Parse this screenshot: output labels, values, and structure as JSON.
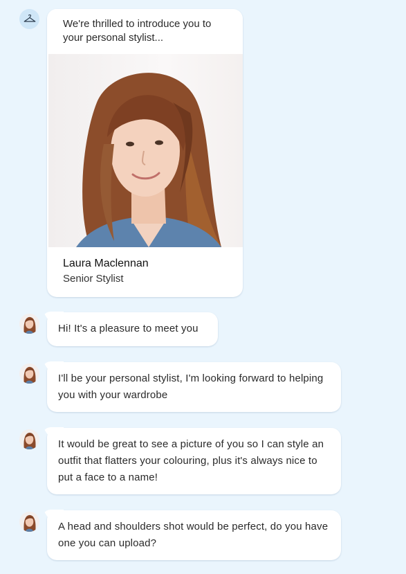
{
  "intro": {
    "text": "We're thrilled to introduce you to your personal stylist...",
    "stylist_name": "Laura Maclennan",
    "stylist_role": "Senior Stylist",
    "photo_icon": "stylist-portrait",
    "bot_icon": "hanger-icon"
  },
  "messages": [
    {
      "text": "Hi! It's a pleasure to meet you"
    },
    {
      "text": "I'll be your personal stylist, I'm looking forward to helping you with your wardrobe"
    },
    {
      "text": "It would be great to see a picture of you so I can style an outfit that flatters your colouring, plus it's always nice to put a face to a name!"
    },
    {
      "text": "A head and shoulders shot would be perfect, do you have one you can upload?"
    }
  ],
  "colors": {
    "background": "#eaf5fd",
    "bubble": "#ffffff",
    "bot_avatar": "#cfe6f7"
  }
}
